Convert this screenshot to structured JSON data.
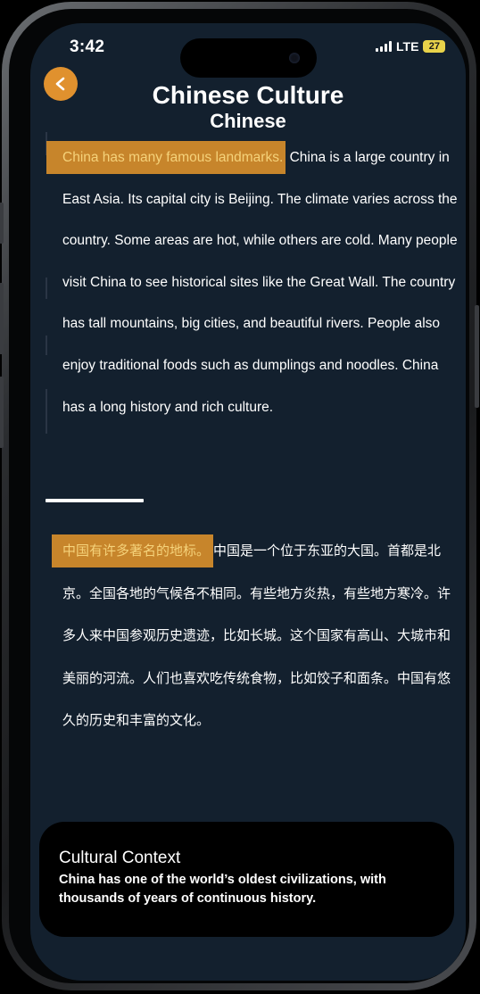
{
  "status": {
    "time": "3:42",
    "network": "LTE",
    "battery": "27"
  },
  "header": {
    "back_label": "<",
    "title": "Chinese Culture",
    "subtitle": "Chinese"
  },
  "english": {
    "highlight": "China has many famous landmarks.",
    "rest": " China is a large country in East Asia. Its capital city is Beijing. The climate varies across the country. Some areas are hot, while others are cold. Many people visit China to see historical sites like the Great Wall. The country has tall mountains, big cities, and beautiful rivers. People also enjoy traditional foods such as dumplings and noodles. China has a long history and rich culture."
  },
  "chinese": {
    "highlight": "中国有许多著名的地标。",
    "rest": "中国是一个位于东亚的大国。首都是北京。全国各地的气候各不相同。有些地方炎热，有些地方寒冷。许多人来中国参观历史遗迹，比如长城。这个国家有高山、大城市和美丽的河流。人们也喜欢吃传统食物，比如饺子和面条。中国有悠久的历史和丰富的文化。"
  },
  "context": {
    "title": "Cultural Context",
    "body": "China has one of the world’s oldest civilizations, with thousands of years of continuous history."
  },
  "colors": {
    "background": "#13202e",
    "accent": "#e0912e",
    "highlight": "#c7852b",
    "highlight_text": "#f5d27a"
  }
}
